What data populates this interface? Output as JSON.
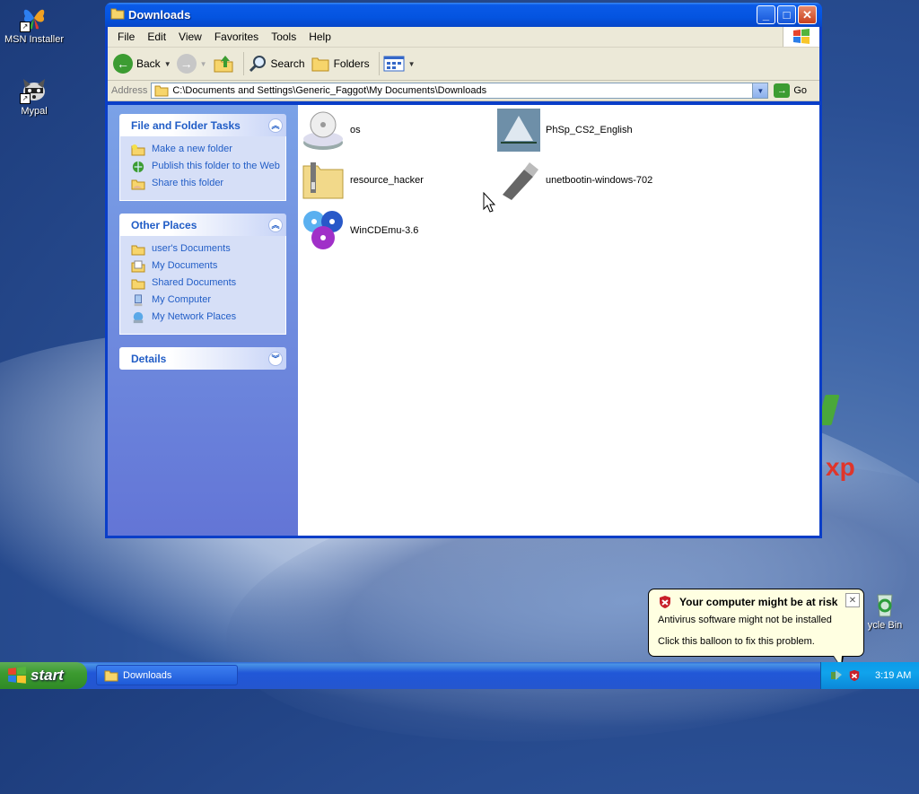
{
  "desktop": {
    "icons": [
      {
        "label": "MSN Installer"
      },
      {
        "label": "Mypal"
      },
      {
        "label": "ycle Bin"
      }
    ]
  },
  "window": {
    "title": "Downloads",
    "menu": [
      "File",
      "Edit",
      "View",
      "Favorites",
      "Tools",
      "Help"
    ],
    "toolbar": {
      "back": "Back",
      "search": "Search",
      "folders": "Folders"
    },
    "address": {
      "label": "Address",
      "path": "C:\\Documents and Settings\\Generic_Faggot\\My Documents\\Downloads",
      "go": "Go"
    },
    "sidebar": {
      "file_tasks": {
        "title": "File and Folder Tasks",
        "items": [
          "Make a new folder",
          "Publish this folder to the Web",
          "Share this folder"
        ]
      },
      "other_places": {
        "title": "Other Places",
        "items": [
          "user's Documents",
          "My Documents",
          "Shared Documents",
          "My Computer",
          "My Network Places"
        ]
      },
      "details": {
        "title": "Details"
      }
    },
    "files": [
      "os",
      "PhSp_CS2_English",
      "resource_hacker",
      "unetbootin-windows-702",
      "WinCDEmu-3.6"
    ]
  },
  "taskbar": {
    "start": "start",
    "task": "Downloads",
    "clock": "3:19 AM"
  },
  "balloon": {
    "title": "Your computer might be at risk",
    "line1": "Antivirus software might not be installed",
    "line2": "Click this balloon to fix this problem."
  },
  "colors": {
    "titlebar": "#0454e0",
    "link": "#215dc6",
    "start": "#3c9b30",
    "balloon_bg": "#ffffe1"
  }
}
